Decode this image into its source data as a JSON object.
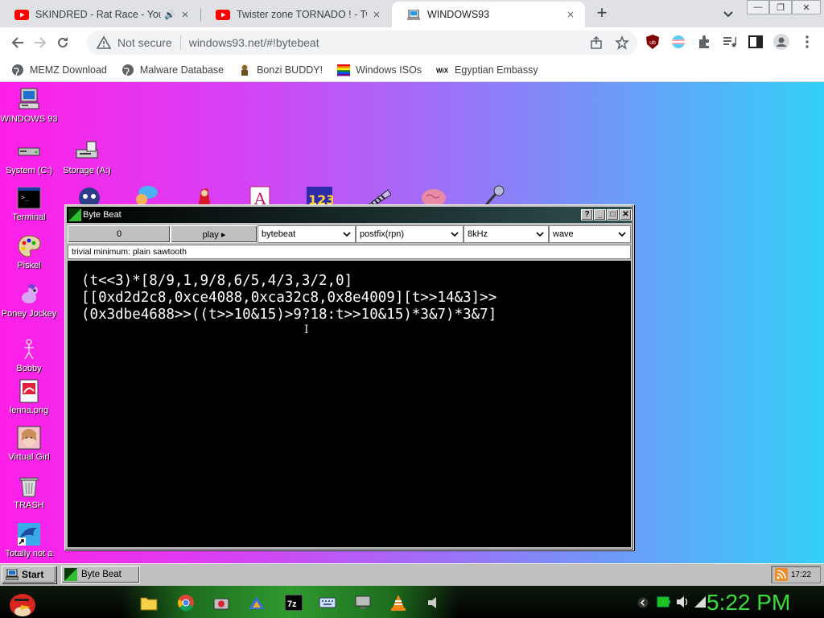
{
  "browser": {
    "tabs": [
      {
        "title": "SKINDRED - Rat Race - YouTube"
      },
      {
        "title": "Twister zone TORNADO ! - Twister"
      },
      {
        "title": "WINDOWS93"
      }
    ],
    "new_tab": "+",
    "omnibox": {
      "security_label": "Not secure",
      "url": "windows93.net/#!bytebeat"
    },
    "bookmarks": [
      {
        "label": "MEMZ Download",
        "icon": "globe-icon"
      },
      {
        "label": "Malware Database",
        "icon": "globe-icon"
      },
      {
        "label": "Bonzi BUDDY!",
        "icon": "bonzi-icon"
      },
      {
        "label": "Windows ISOs",
        "icon": "rainbow-icon"
      },
      {
        "label": "Egyptian Embassy",
        "icon": "wix-icon"
      }
    ],
    "window_buttons": {
      "minimize": "—",
      "restore": "❐",
      "close": "✕"
    }
  },
  "desktop": {
    "icons": [
      {
        "label": "WINDOWS 93"
      },
      {
        "label": "System (C:)"
      },
      {
        "label": "Storage (A:)"
      },
      {
        "label": "Terminal"
      },
      {
        "label": "Piskel"
      },
      {
        "label": "Poney Jockey"
      },
      {
        "label": "Bobby"
      },
      {
        "label": "lenna.png"
      },
      {
        "label": "Virtual Girl"
      },
      {
        "label": "TRASH"
      },
      {
        "label": "Totally not a"
      }
    ]
  },
  "bytebeat": {
    "title": "Byte Beat",
    "titlebar_buttons": [
      "?",
      "_",
      "□",
      "✕"
    ],
    "counter": "0",
    "play_label": "play ▸",
    "mode": "bytebeat",
    "notation": "postfix(rpn)",
    "rate": "8kHz",
    "view": "wave",
    "hint": "trivial minimum: plain sawtooth",
    "code_line1": "(t<<3)*[8/9,1,9/8,6/5,4/3,3/2,0]",
    "code_line2": "[[0xd2d2c8,0xce4088,0xca32c8,0x8e4009][t>>14&3]>>",
    "code_line3": "(0x3dbe4688>>((t>>10&15)>9?18:t>>10&15)*3&7)*3&7]"
  },
  "w93_taskbar": {
    "start_label": "Start",
    "task_label": "Byte Beat",
    "tray_time": "17:22"
  },
  "os_taskbar": {
    "clock": "5:22 PM"
  },
  "colors": {
    "desktop_gradient": [
      "#ff1ee8",
      "#33d0f8"
    ],
    "clock_green": "#3ddc3d"
  }
}
